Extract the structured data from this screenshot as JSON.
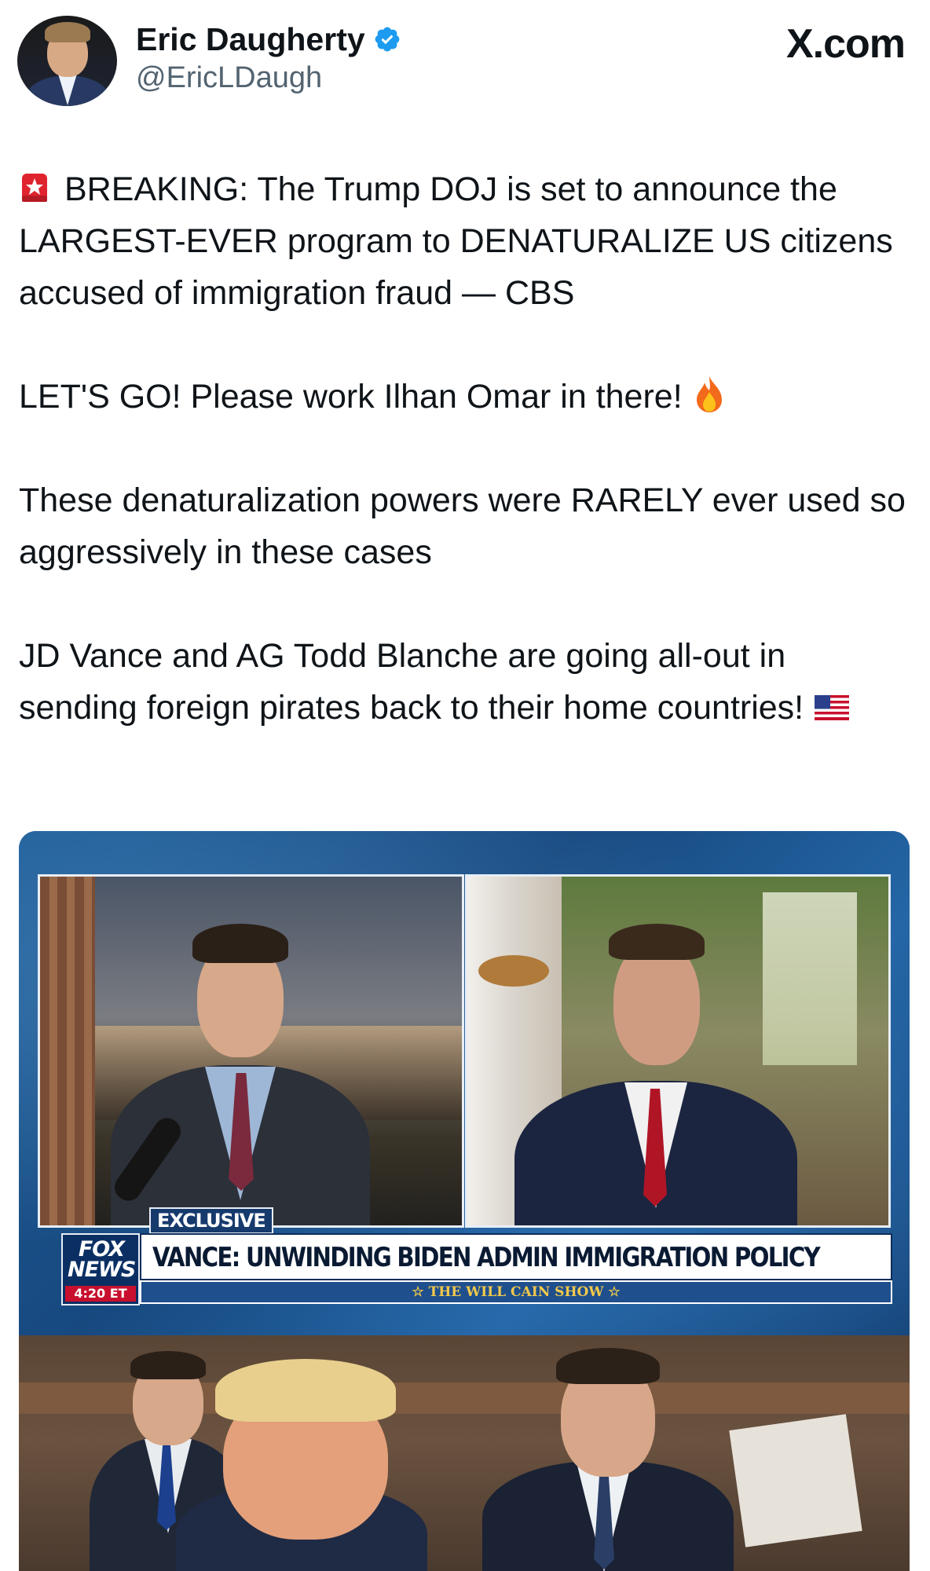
{
  "author": {
    "display_name": "Eric Daugherty",
    "handle": "@EricLDaugh",
    "verified": true,
    "verified_color": "#1d9bf0"
  },
  "site": "X.com",
  "tweet": {
    "paragraphs": [
      {
        "emoji_before": "siren-icon",
        "text": "BREAKING: The Trump DOJ is set to announce the LARGEST-EVER program to DENATURALIZE US citizens accused of immigration fraud — CBS"
      },
      {
        "text": "LET'S GO! Please work Ilhan Omar in there!",
        "emoji_after": "fire-icon"
      },
      {
        "text": "These denaturalization powers were RARELY ever used so aggressively in these cases"
      },
      {
        "text": "JD Vance and AG Todd Blanche are going all-out in sending foreign pirates back to their home countries!",
        "emoji_after": "us-flag-icon"
      }
    ]
  },
  "media": {
    "exclusive_label": "EXCLUSIVE",
    "headline": "VANCE: UNWINDING BIDEN ADMIN IMMIGRATION POLICY",
    "show_name": "☆ THE WILL CAIN SHOW ☆",
    "network_logo_line1": "FOX",
    "network_logo_line2": "NEWS",
    "time": "4:20 ET",
    "colors": {
      "background": "#1a4d85",
      "banner": "#ffffff",
      "time_badge": "#c8102e",
      "show_text": "#f2c94c"
    }
  }
}
